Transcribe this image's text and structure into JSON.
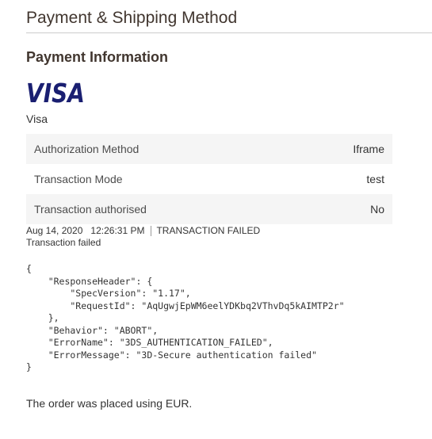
{
  "section": {
    "title": "Payment & Shipping Method"
  },
  "payment": {
    "subtitle": "Payment Information",
    "logo_icon": "visa-logo-icon",
    "brand_color": "#1a1f71",
    "method_name": "Visa",
    "details": [
      {
        "label": "Authorization Method",
        "value": "Iframe"
      },
      {
        "label": "Transaction Mode",
        "value": "test"
      },
      {
        "label": "Transaction authorised",
        "value": "No"
      }
    ]
  },
  "transaction": {
    "date": "Aug 14, 2020",
    "time": "12:26:31 PM",
    "status": "TRANSACTION FAILED",
    "note": "Transaction failed",
    "response": "{\n    \"ResponseHeader\": {\n        \"SpecVersion\": \"1.17\",\n        \"RequestId\": \"AqUgwjEpWM6eelYDKbq2VThvDq5kAIMTP2r\"\n    },\n    \"Behavior\": \"ABORT\",\n    \"ErrorName\": \"3DS_AUTHENTICATION_FAILED\",\n    \"ErrorMessage\": \"3D-Secure authentication failed\"\n}"
  },
  "footer": {
    "currency_note": "The order was placed using EUR."
  }
}
